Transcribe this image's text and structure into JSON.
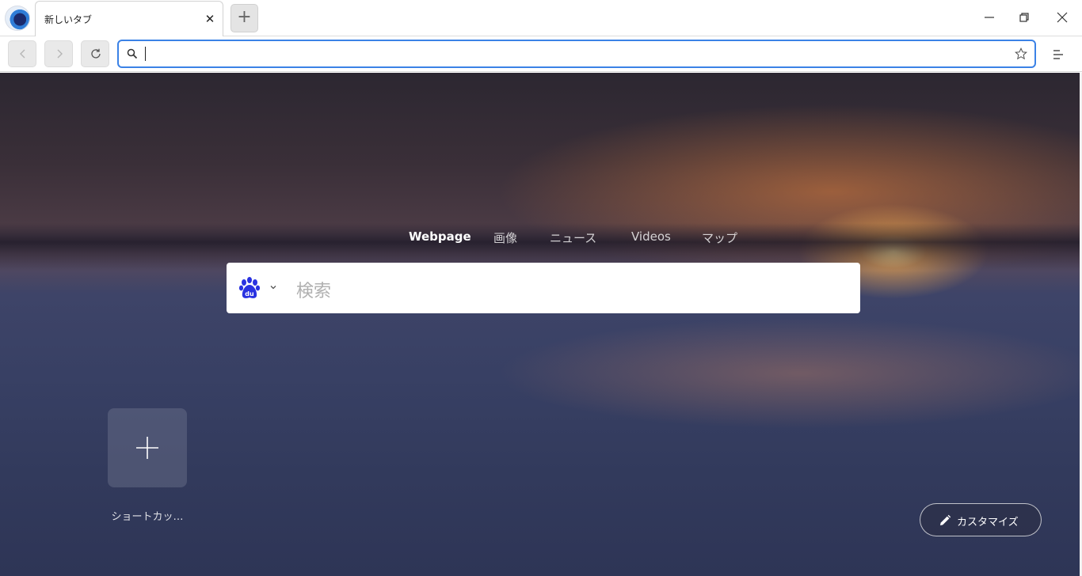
{
  "tab": {
    "title": "新しいタブ",
    "close_icon": "close-icon"
  },
  "new_tab": {
    "label": "+"
  },
  "address_bar": {
    "value": "",
    "placeholder": ""
  },
  "search": {
    "tabs": [
      {
        "label": "Webpage",
        "active": true
      },
      {
        "label": "画像",
        "active": false
      },
      {
        "label": "ニュース",
        "active": false
      },
      {
        "label": "Videos",
        "active": false
      },
      {
        "label": "マップ",
        "active": false
      }
    ],
    "engine": "baidu-paw-icon",
    "placeholder": "検索"
  },
  "shortcut": {
    "label": "ショートカッ…"
  },
  "customize": {
    "label": "カスタマイズ"
  },
  "colors": {
    "accent": "#3b82e6",
    "engine_blue": "#2932e1"
  }
}
